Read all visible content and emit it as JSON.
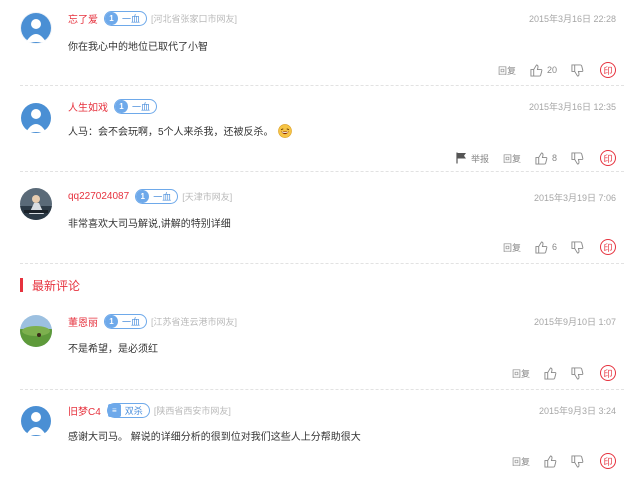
{
  "hot_comments": [
    {
      "username": "忘了爱",
      "level_num": "1",
      "level_label": "一血",
      "location": "[河北省张家口市网友]",
      "time": "2015年3月16日 22:28",
      "text": "你在我心中的地位已取代了小智",
      "reply_label": "回复",
      "likes": "20"
    },
    {
      "username": "人生如戏",
      "level_num": "1",
      "level_label": "一血",
      "location": "",
      "time": "2015年3月16日 12:35",
      "text": "人马：会不会玩啊，5个人来杀我，还被反杀。",
      "report_label": "举报",
      "reply_label": "回复",
      "likes": "8"
    },
    {
      "username": "qq227024087",
      "level_num": "1",
      "level_label": "一血",
      "location": "[天津市网友]",
      "time": "2015年3月19日 7:06",
      "text": "非常喜欢大司马解说,讲解的特别详细",
      "reply_label": "回复",
      "likes": "6"
    }
  ],
  "latest_section_title": "最新评论",
  "latest_comments": [
    {
      "username": "董恩丽",
      "level_num": "1",
      "level_label": "一血",
      "location": "[江苏省连云港市网友]",
      "time": "2015年9月10日 1:07",
      "text": "不是希望，是必须红",
      "reply_label": "回复"
    },
    {
      "username": "旧梦C4",
      "level_num": "≡",
      "level_label": "双杀",
      "location": "[陕西省西安市网友]",
      "time": "2015年9月3日 3:24",
      "text": "感谢大司马。 解说的详细分析的很到位对我们这些人上分帮助很大",
      "reply_label": "回复"
    }
  ],
  "yin_label": "印",
  "icons": {
    "like": "thumbs-up-icon",
    "dislike": "thumbs-down-icon",
    "report": "flag-icon",
    "emoji": "laughing-emoji-icon"
  },
  "colors": {
    "accent_red": "#e6323e",
    "level_blue": "#6ea9ea",
    "muted": "#a6a6a6"
  }
}
